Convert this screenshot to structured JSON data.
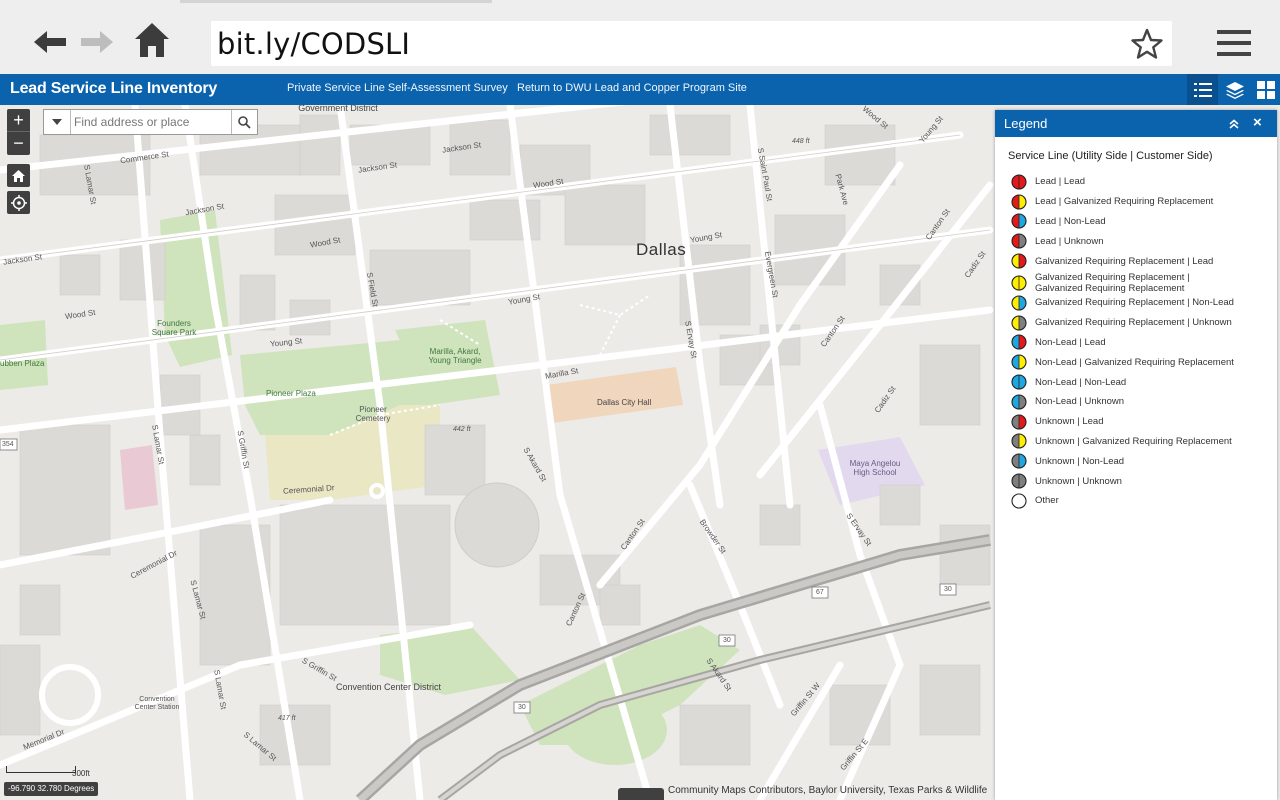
{
  "browser": {
    "url": "bit.ly/CODSLI",
    "back_icon": "arrow-left-icon",
    "forward_icon": "arrow-right-icon",
    "home_icon": "house-icon",
    "bookmark_icon": "star-icon",
    "menu_icon": "hamburger-menu-icon"
  },
  "header": {
    "title": "Lead Service Line Inventory",
    "links": [
      "Private Service Line Self-Assessment Survey",
      "Return to DWU Lead and Copper Program Site"
    ],
    "tools": [
      "legend-list-icon",
      "layers-icon",
      "basemap-gallery-icon"
    ]
  },
  "map": {
    "search_placeholder": "Find address or place",
    "zoom_in": "+",
    "zoom_out": "−",
    "scale": "300ft",
    "coordinates": "-96.790 32.780 Degrees",
    "attribution": "Community Maps Contributors, Baylor University, Texas Parks & Wildlife",
    "labels": {
      "city": "Dallas",
      "gov_district": "Government District",
      "convention_district": "Convention Center District",
      "city_hall": "Dallas City Hall",
      "pioneer_plaza": "Pioneer Plaza",
      "pioneer_cemetery": "Pioneer Cemetery",
      "founders_park": "Founders Square Park",
      "marilla_triangle": "Marilla, Akard, Young Triangle",
      "maya_angelou": "Maya Angelou High School",
      "convention_station": "Convention Center Station",
      "ruben_plaza": "ubben Plaza",
      "elev_448": "448 ft",
      "elev_442": "442 ft",
      "elev_417": "417 ft",
      "hwy_30a": "30",
      "hwy_30b": "30",
      "hwy_30c": "30",
      "hwy_67": "67",
      "route_354": "354",
      "streets": {
        "commerce": "Commerce St",
        "jackson1": "Jackson St",
        "jackson2": "Jackson St",
        "jackson3": "Jackson St",
        "jackson4": "Jackson St",
        "wood1": "Wood St",
        "wood2": "Wood St",
        "wood3": "Wood St",
        "young1": "Young St",
        "young2": "Young St",
        "young3": "Young St",
        "young4": "Young St",
        "marilla": "Marilla St",
        "ceremonial1": "Ceremonial Dr",
        "ceremonial2": "Ceremonial Dr",
        "memorial": "Memorial Dr",
        "lamar1": "S Lamar St",
        "lamar2": "S Lamar St",
        "lamar3": "S Lamar St",
        "lamar4": "S Lamar St",
        "lamar5": "S Lamar St",
        "griffin1": "S Griffin St",
        "griffin2": "S Griffin St",
        "field": "S Field St",
        "ervay1": "S Ervay St",
        "ervay2": "S Ervay St",
        "akard1": "S Akard St",
        "akard2": "S Akard St",
        "canton1": "Canton St",
        "canton2": "Canton St",
        "canton3": "Canton St",
        "canton4": "Canton St",
        "browder": "Browder St",
        "cadiz1": "Cadiz St",
        "cadiz2": "Cadiz St",
        "saint_paul": "S Saint Paul St",
        "park": "Park Ave",
        "evergreen": "Evergreen St",
        "griffin_w": "Griffin St W",
        "griffin_e": "Griffin St E",
        "wood_ne": "Wood St"
      }
    }
  },
  "legend": {
    "title": "Legend",
    "collapse_icon": "double-chevron-up-icon",
    "close_icon": "close-icon",
    "layer_title": "Service Line (Utility Side | Customer Side)",
    "colors": {
      "lead": "#e31a1c",
      "galvanized": "#ffee00",
      "nonlead": "#1ea7e1",
      "unknown": "#7f7f7f"
    },
    "items": [
      {
        "label": "Lead | Lead",
        "left": "lead",
        "right": "lead"
      },
      {
        "label": "Lead | Galvanized Requiring Replacement",
        "left": "lead",
        "right": "galvanized"
      },
      {
        "label": "Lead | Non-Lead",
        "left": "lead",
        "right": "nonlead"
      },
      {
        "label": "Lead | Unknown",
        "left": "lead",
        "right": "unknown"
      },
      {
        "label": "Galvanized Requiring Replacement | Lead",
        "left": "galvanized",
        "right": "lead"
      },
      {
        "label": "Galvanized Requiring Replacement | Galvanized Requiring Replacement",
        "left": "galvanized",
        "right": "galvanized"
      },
      {
        "label": "Galvanized Requiring Replacement | Non-Lead",
        "left": "galvanized",
        "right": "nonlead"
      },
      {
        "label": "Galvanized Requiring Replacement | Unknown",
        "left": "galvanized",
        "right": "unknown"
      },
      {
        "label": "Non-Lead | Lead",
        "left": "nonlead",
        "right": "lead"
      },
      {
        "label": "Non-Lead | Galvanized Requiring Replacement",
        "left": "nonlead",
        "right": "galvanized"
      },
      {
        "label": "Non-Lead | Non-Lead",
        "left": "nonlead",
        "right": "nonlead"
      },
      {
        "label": "Non-Lead | Unknown",
        "left": "nonlead",
        "right": "unknown"
      },
      {
        "label": "Unknown | Lead",
        "left": "unknown",
        "right": "lead"
      },
      {
        "label": "Unknown | Galvanized Requiring Replacement",
        "left": "unknown",
        "right": "galvanized"
      },
      {
        "label": "Unknown | Non-Lead",
        "left": "unknown",
        "right": "nonlead"
      },
      {
        "label": "Unknown | Unknown",
        "left": "unknown",
        "right": "unknown"
      },
      {
        "label": "Other",
        "left": "",
        "right": ""
      }
    ]
  }
}
